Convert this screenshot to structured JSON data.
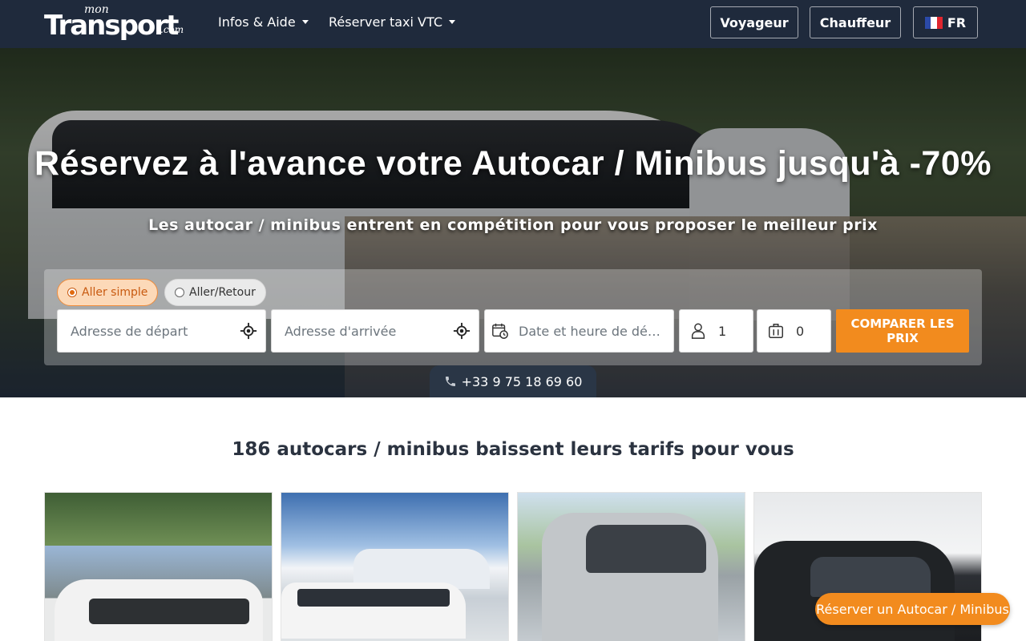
{
  "brand": {
    "logo_small": "mon",
    "logo_main": "Transport",
    "logo_suffix": ".com"
  },
  "nav": {
    "links": [
      {
        "label": "Infos & Aide"
      },
      {
        "label": "Réserver taxi VTC"
      }
    ],
    "buttons": {
      "voyageur": "Voyageur",
      "chauffeur": "Chauffeur",
      "language": "FR"
    }
  },
  "hero": {
    "title": "Réservez à l'avance votre Autocar / Minibus jusqu'à -70%",
    "subtitle": "Les autocar / minibus entrent en compétition pour vous proposer le meilleur prix"
  },
  "search": {
    "trip_type": {
      "one_way": "Aller simple",
      "round_trip": "Aller/Retour",
      "selected": "Aller simple"
    },
    "departure_placeholder": "Adresse de départ",
    "arrival_placeholder": "Adresse d'arrivée",
    "date_placeholder": "Date et heure de dép...",
    "passengers": "1",
    "luggage": "0",
    "compare_button": "COMPARER LES PRIX"
  },
  "phone": "+33 9 75 18 69 60",
  "content": {
    "section_title": "186 autocars / minibus baissent leurs tarifs pour vous"
  },
  "floating_button": "Réserver un Autocar / Minibus",
  "colors": {
    "navbar": "#1f2a3c",
    "accent": "#f28b1e"
  },
  "icons": {
    "locate": "crosshair-icon",
    "calendar": "calendar-clock-icon",
    "passenger": "person-icon",
    "luggage": "suitcase-icon",
    "phone": "phone-icon"
  }
}
